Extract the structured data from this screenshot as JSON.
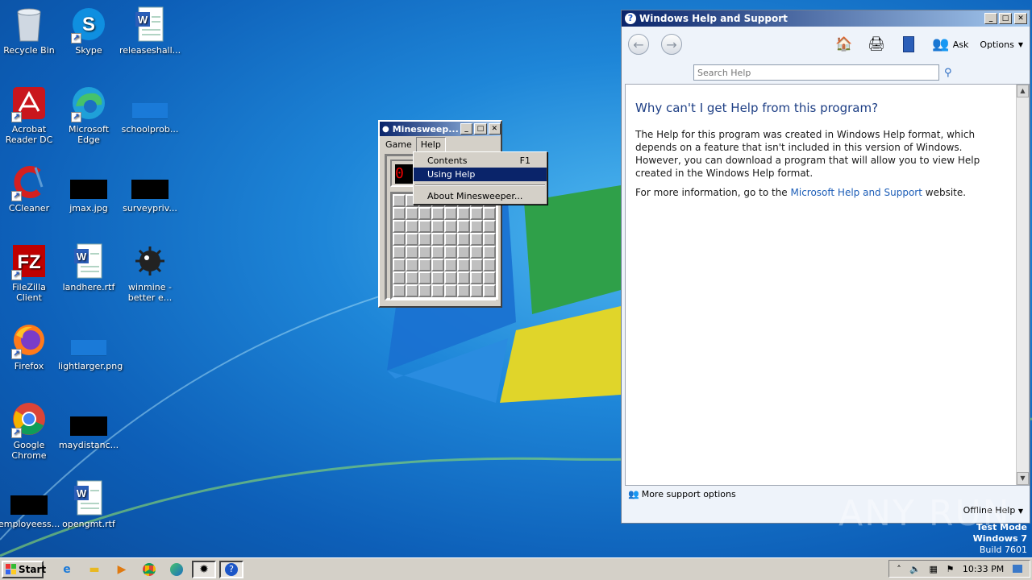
{
  "desktop": {
    "icons": [
      {
        "label": "Recycle Bin"
      },
      {
        "label": "Skype"
      },
      {
        "label": "releaseshall..."
      },
      {
        "label": "Acrobat Reader DC"
      },
      {
        "label": "Microsoft Edge"
      },
      {
        "label": "schoolprob..."
      },
      {
        "label": "CCleaner"
      },
      {
        "label": "jmax.jpg"
      },
      {
        "label": "surveypriv..."
      },
      {
        "label": "FileZilla Client"
      },
      {
        "label": "landhere.rtf"
      },
      {
        "label": "winmine - better e..."
      },
      {
        "label": "Firefox"
      },
      {
        "label": "lightlarger.png"
      },
      {
        "label": "Google Chrome"
      },
      {
        "label": "maydistanc..."
      },
      {
        "label": "employeess..."
      },
      {
        "label": "opengmt.rtf"
      }
    ]
  },
  "minesweeper": {
    "title": "Minesweep...",
    "menu": [
      "Game",
      "Help"
    ],
    "help_menu": {
      "items": [
        {
          "label": "Contents",
          "shortcut": "F1"
        },
        {
          "label": "Using Help",
          "shortcut": ""
        },
        {
          "label": "About Minesweeper...",
          "shortcut": ""
        }
      ],
      "selected": "Using Help"
    }
  },
  "help_window": {
    "title": "Windows Help and Support",
    "toolbar": {
      "ask": "Ask",
      "options": "Options"
    },
    "search_placeholder": "Search Help",
    "heading": "Why can't I get Help from this program?",
    "paragraph1": "The Help for this program was created in Windows Help format, which depends on a feature that isn't included in this version of Windows. However, you can download a program that will allow you to view Help created in the Windows Help format.",
    "paragraph2_prefix": "For more information, go to the ",
    "paragraph2_link": "Microsoft Help and Support",
    "paragraph2_suffix": " website.",
    "footer_left": "More support options",
    "footer_right": "Offline Help"
  },
  "taskbar": {
    "start_label": "Start",
    "clock": "10:33 PM"
  },
  "watermark": {
    "line1": "Test Mode",
    "line2": "Windows 7",
    "line3": "Build 7601",
    "brand": "ANY RUN"
  }
}
